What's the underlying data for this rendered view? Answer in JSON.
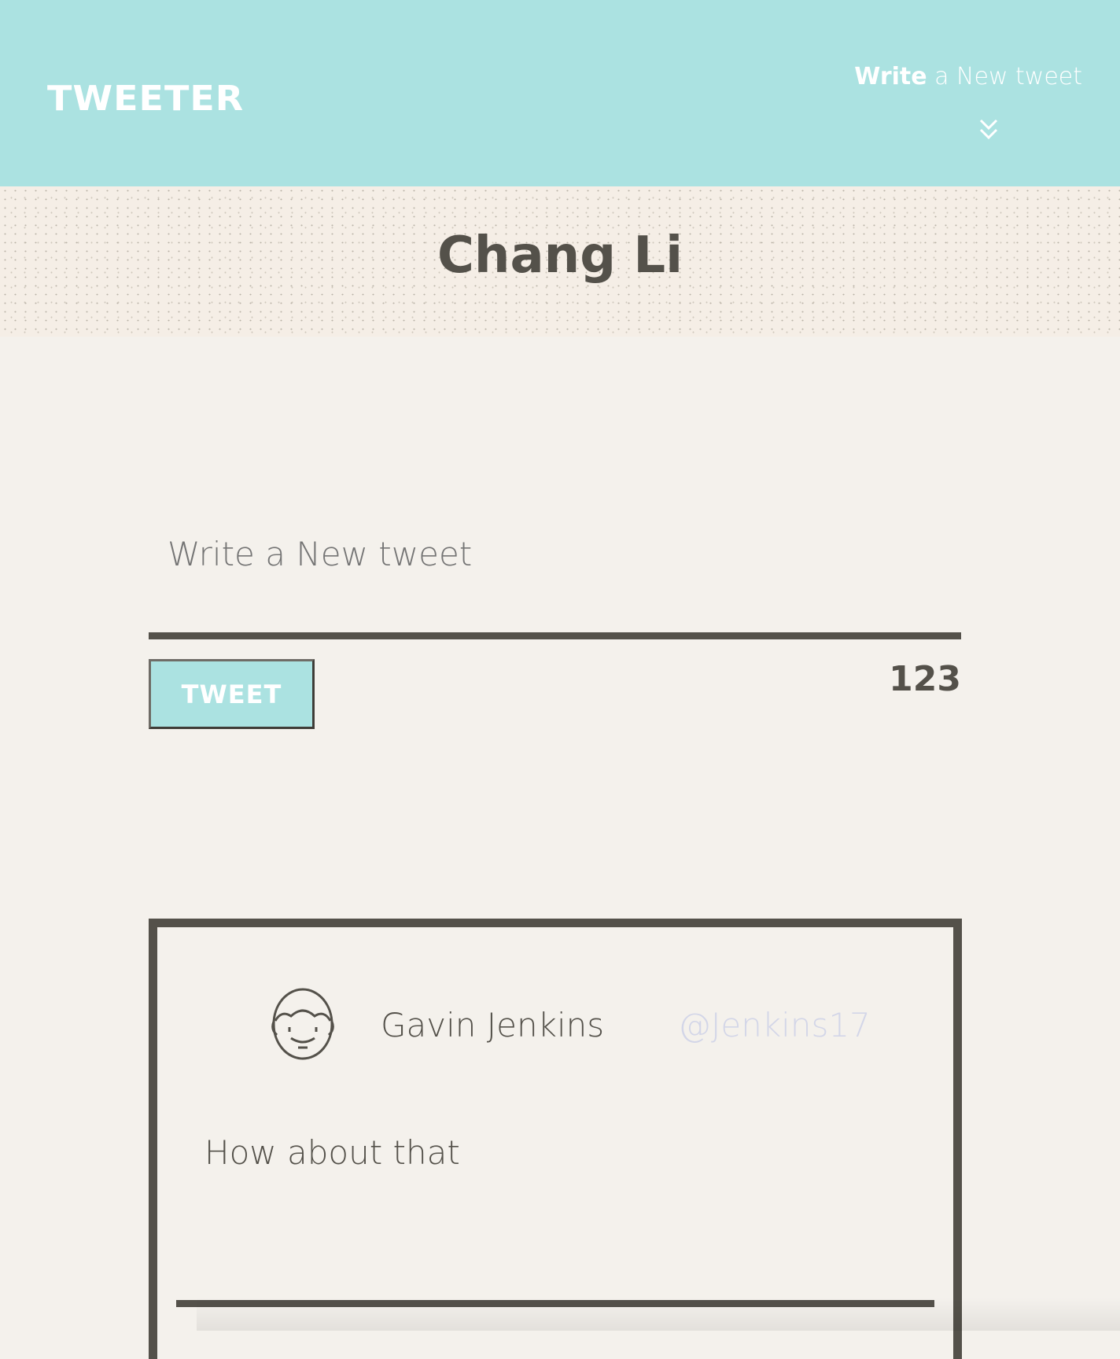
{
  "header": {
    "logo": "TWEETER",
    "nav_write_bold": "Write",
    "nav_write_rest": " a New tweet",
    "chevron_icon": "double-chevron-down-icon",
    "background": "#abe2e1"
  },
  "profile": {
    "name": "Chang Li"
  },
  "compose": {
    "placeholder": "Write a New tweet",
    "button_label": "TWEET",
    "counter": "123"
  },
  "tweets": [
    {
      "avatar_icon": "face-avatar-icon",
      "author": "Gavin Jenkins",
      "handle": "@Jenkins17",
      "content": "How about that"
    }
  ]
}
